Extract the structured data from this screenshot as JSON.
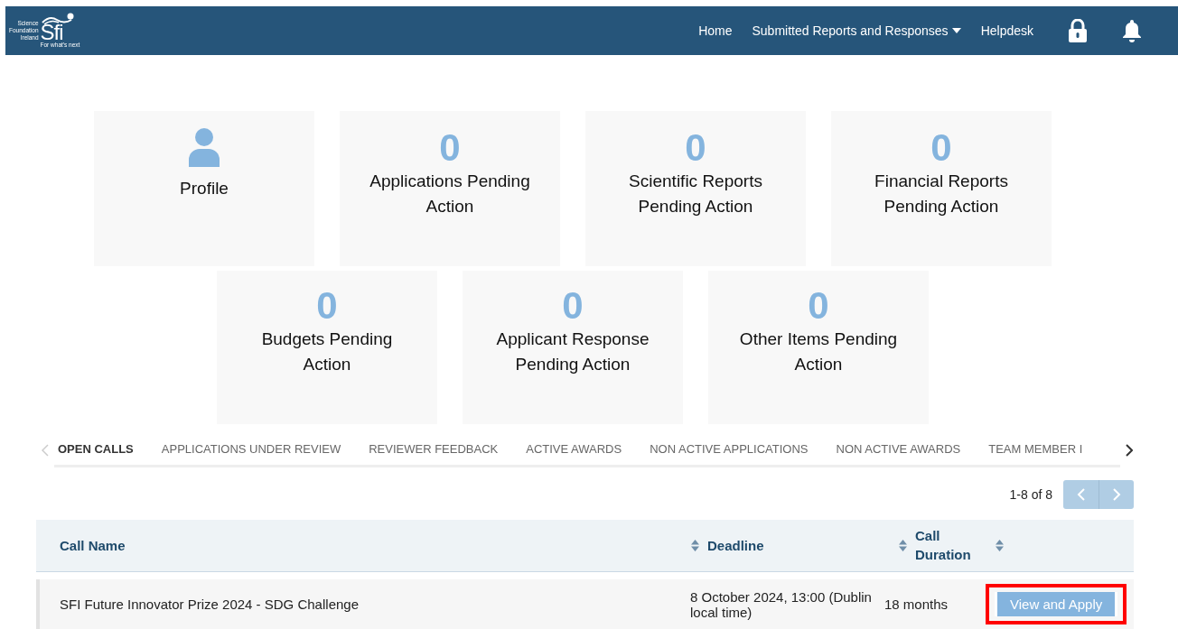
{
  "header": {
    "logo": {
      "org_lines": [
        "Science",
        "Foundation",
        "Ireland"
      ],
      "mark": "Sfi",
      "tagline": "For what's next"
    },
    "nav": [
      {
        "label": "Home",
        "dropdown": false
      },
      {
        "label": "Submitted Reports and Responses",
        "dropdown": true
      },
      {
        "label": "Helpdesk",
        "dropdown": false
      }
    ]
  },
  "tiles": [
    {
      "kind": "profile",
      "label": "Profile"
    },
    {
      "kind": "count",
      "count": "0",
      "label": "Applications Pending Action"
    },
    {
      "kind": "count",
      "count": "0",
      "label": "Scientific Reports Pending Action"
    },
    {
      "kind": "count",
      "count": "0",
      "label": "Financial Reports Pending Action"
    },
    {
      "kind": "count",
      "count": "0",
      "label": "Budgets Pending Action"
    },
    {
      "kind": "count",
      "count": "0",
      "label": "Applicant Response Pending Action"
    },
    {
      "kind": "count",
      "count": "0",
      "label": "Other Items Pending Action"
    }
  ],
  "tabs": [
    {
      "label": "OPEN CALLS",
      "selected": true
    },
    {
      "label": "APPLICATIONS UNDER REVIEW",
      "selected": false
    },
    {
      "label": "REVIEWER FEEDBACK",
      "selected": false
    },
    {
      "label": "ACTIVE AWARDS",
      "selected": false
    },
    {
      "label": "NON ACTIVE APPLICATIONS",
      "selected": false
    },
    {
      "label": "NON ACTIVE AWARDS",
      "selected": false
    },
    {
      "label": "TEAM MEMBER I",
      "selected": false
    }
  ],
  "pagination": {
    "range": "1-8 of 8"
  },
  "table": {
    "columns": [
      {
        "label": "Call Name",
        "sortable": false
      },
      {
        "label": "Deadline",
        "sortable": true
      },
      {
        "label": "Call Duration",
        "sortable": true
      },
      {
        "sortable": true
      }
    ],
    "rows": [
      {
        "name": "SFI Future Innovator Prize 2024 - SDG Challenge",
        "deadline": "8 October 2024, 13:00 (Dublin local time)",
        "duration": "18 months",
        "action": "View and Apply",
        "highlighted": true
      }
    ]
  }
}
